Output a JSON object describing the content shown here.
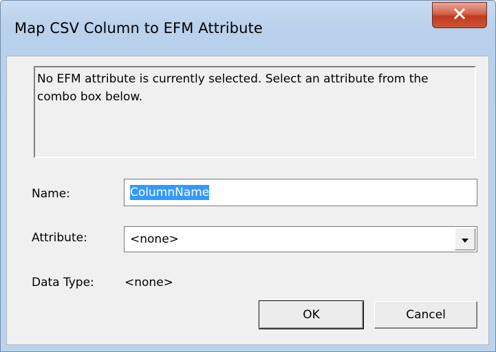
{
  "window": {
    "title": "Map CSV Column to EFM Attribute"
  },
  "titlebar": {
    "close_icon": "close-icon"
  },
  "message": {
    "text_line1": "No EFM attribute is currently selected. Select an attribute from the",
    "text_line2": "combo box below."
  },
  "form": {
    "name_label": "Name:",
    "name_value": "ColumnName",
    "attribute_label": "Attribute:",
    "attribute_value": "<none>",
    "data_type_label": "Data Type:",
    "data_type_value": "<none>"
  },
  "buttons": {
    "ok_label": "OK",
    "cancel_label": "Cancel"
  },
  "colors": {
    "selection": "#3399ff",
    "close_button": "#c7432a",
    "dialog_bg": "#f0f0f0"
  }
}
